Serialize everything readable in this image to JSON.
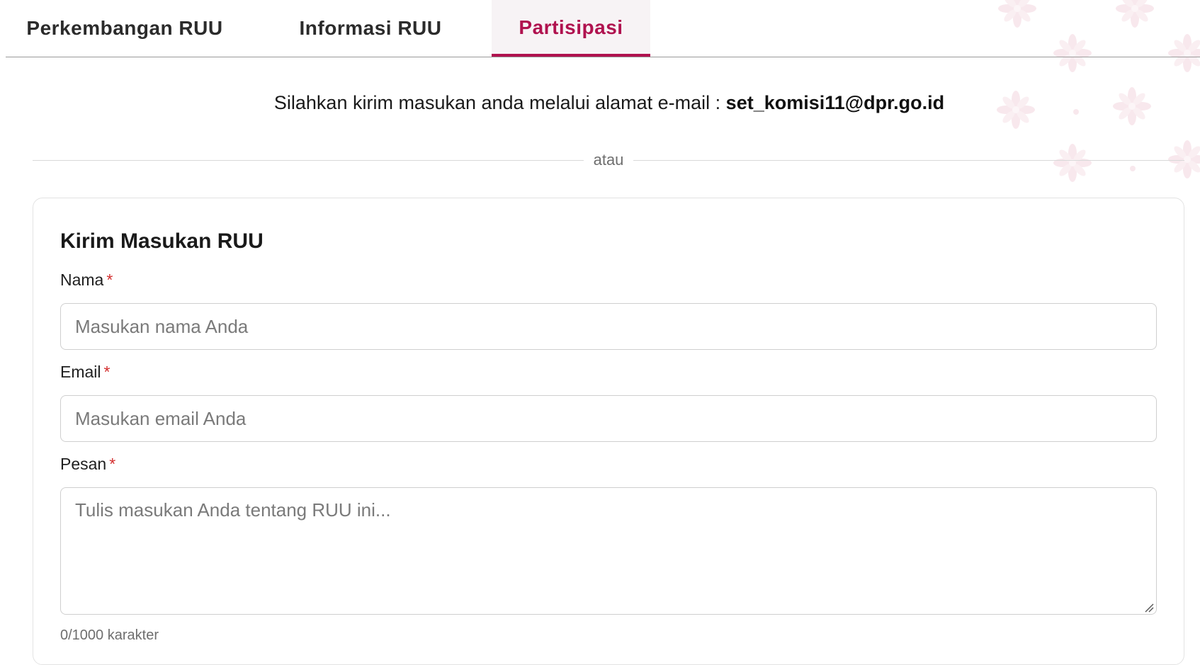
{
  "tabs": [
    {
      "label": "Perkembangan RUU",
      "active": false
    },
    {
      "label": "Informasi RUU",
      "active": false
    },
    {
      "label": "Partisipasi",
      "active": true
    }
  ],
  "email_notice": {
    "text": "Silahkan kirim masukan anda melalui alamat e-mail : ",
    "email": "set_komisi11@dpr.go.id"
  },
  "divider_label": "atau",
  "form": {
    "title": "Kirim Masukan RUU",
    "name": {
      "label": "Nama",
      "required_mark": "*",
      "placeholder": "Masukan nama Anda",
      "value": ""
    },
    "email": {
      "label": "Email",
      "required_mark": "*",
      "placeholder": "Masukan email Anda",
      "value": ""
    },
    "message": {
      "label": "Pesan",
      "required_mark": "*",
      "placeholder": "Tulis masukan Anda tentang RUU ini...",
      "value": ""
    },
    "char_count": "0/1000 karakter"
  },
  "colors": {
    "accent": "#b0124f",
    "required": "#d32f2f",
    "pattern": "#f3d7df"
  },
  "icons": {
    "background_decoration": "floral-pattern-icon",
    "resize": "resize-handle-icon"
  }
}
